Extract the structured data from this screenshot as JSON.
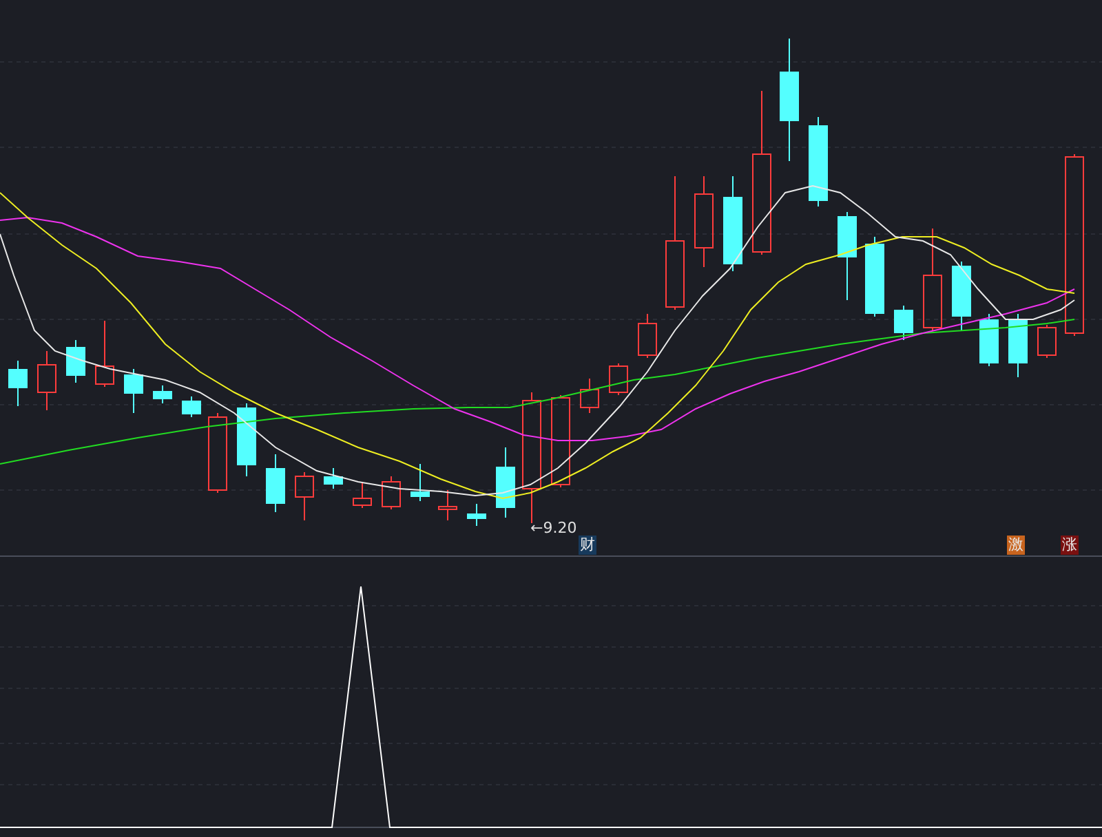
{
  "price_panel": {
    "price_label": "←9.20",
    "markers": [
      {
        "text": "财",
        "color": "#173a5c"
      },
      {
        "text": "激",
        "color": "#c8641e"
      },
      {
        "text": "涨",
        "color": "#7a1010"
      }
    ]
  }
}
